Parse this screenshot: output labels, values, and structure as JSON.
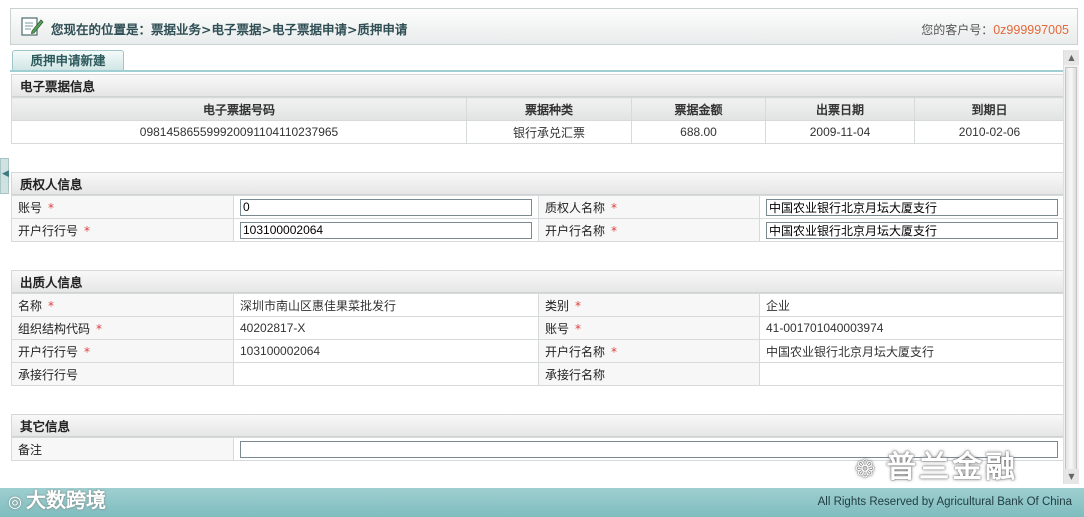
{
  "header": {
    "breadcrumb": "您现在的位置是：票据业务>电子票据>电子票据申请>质押申请",
    "customer_label": "您的客户号：",
    "customer_no": "0z999997005"
  },
  "tab": {
    "label": "质押申请新建"
  },
  "bill_info": {
    "title": "电子票据信息",
    "columns": [
      "电子票据号码",
      "票据种类",
      "票据金额",
      "出票日期",
      "到期日"
    ],
    "row": [
      "098145865599920091104110237965",
      "银行承兑汇票",
      "688.00",
      "2009-11-04",
      "2010-02-06"
    ]
  },
  "pledgee": {
    "title": "质权人信息",
    "account_label": "账号",
    "account_value": "0",
    "name_label": "质权人名称",
    "name_value": "中国农业银行北京月坛大厦支行",
    "bank_no_label": "开户行行号",
    "bank_no_value": "103100002064",
    "bank_name_label": "开户行名称",
    "bank_name_value": "中国农业银行北京月坛大厦支行"
  },
  "pledger": {
    "title": "出质人信息",
    "name_label": "名称",
    "name_value": "深圳市南山区惠佳果菜批发行",
    "type_label": "类别",
    "type_value": "企业",
    "org_code_label": "组织结构代码",
    "org_code_value": "40202817-X",
    "account_label": "账号",
    "account_value": "41-001701040003974",
    "bank_no_label": "开户行行号",
    "bank_no_value": "103100002064",
    "bank_name_label": "开户行名称",
    "bank_name_value": "中国农业银行北京月坛大厦支行",
    "accept_no_label": "承接行行号",
    "accept_no_value": "",
    "accept_name_label": "承接行名称",
    "accept_name_value": ""
  },
  "other": {
    "title": "其它信息",
    "remark_label": "备注",
    "remark_value": ""
  },
  "required_mark": "*",
  "footer": {
    "copyright": "All Rights Reserved by Agricultural Bank Of China"
  },
  "watermarks": {
    "left": "大数跨境",
    "right": "普兰金融"
  },
  "colors": {
    "accent_teal": "#8fc6c8",
    "customer_no": "#e4683a",
    "required": "#e04040"
  }
}
